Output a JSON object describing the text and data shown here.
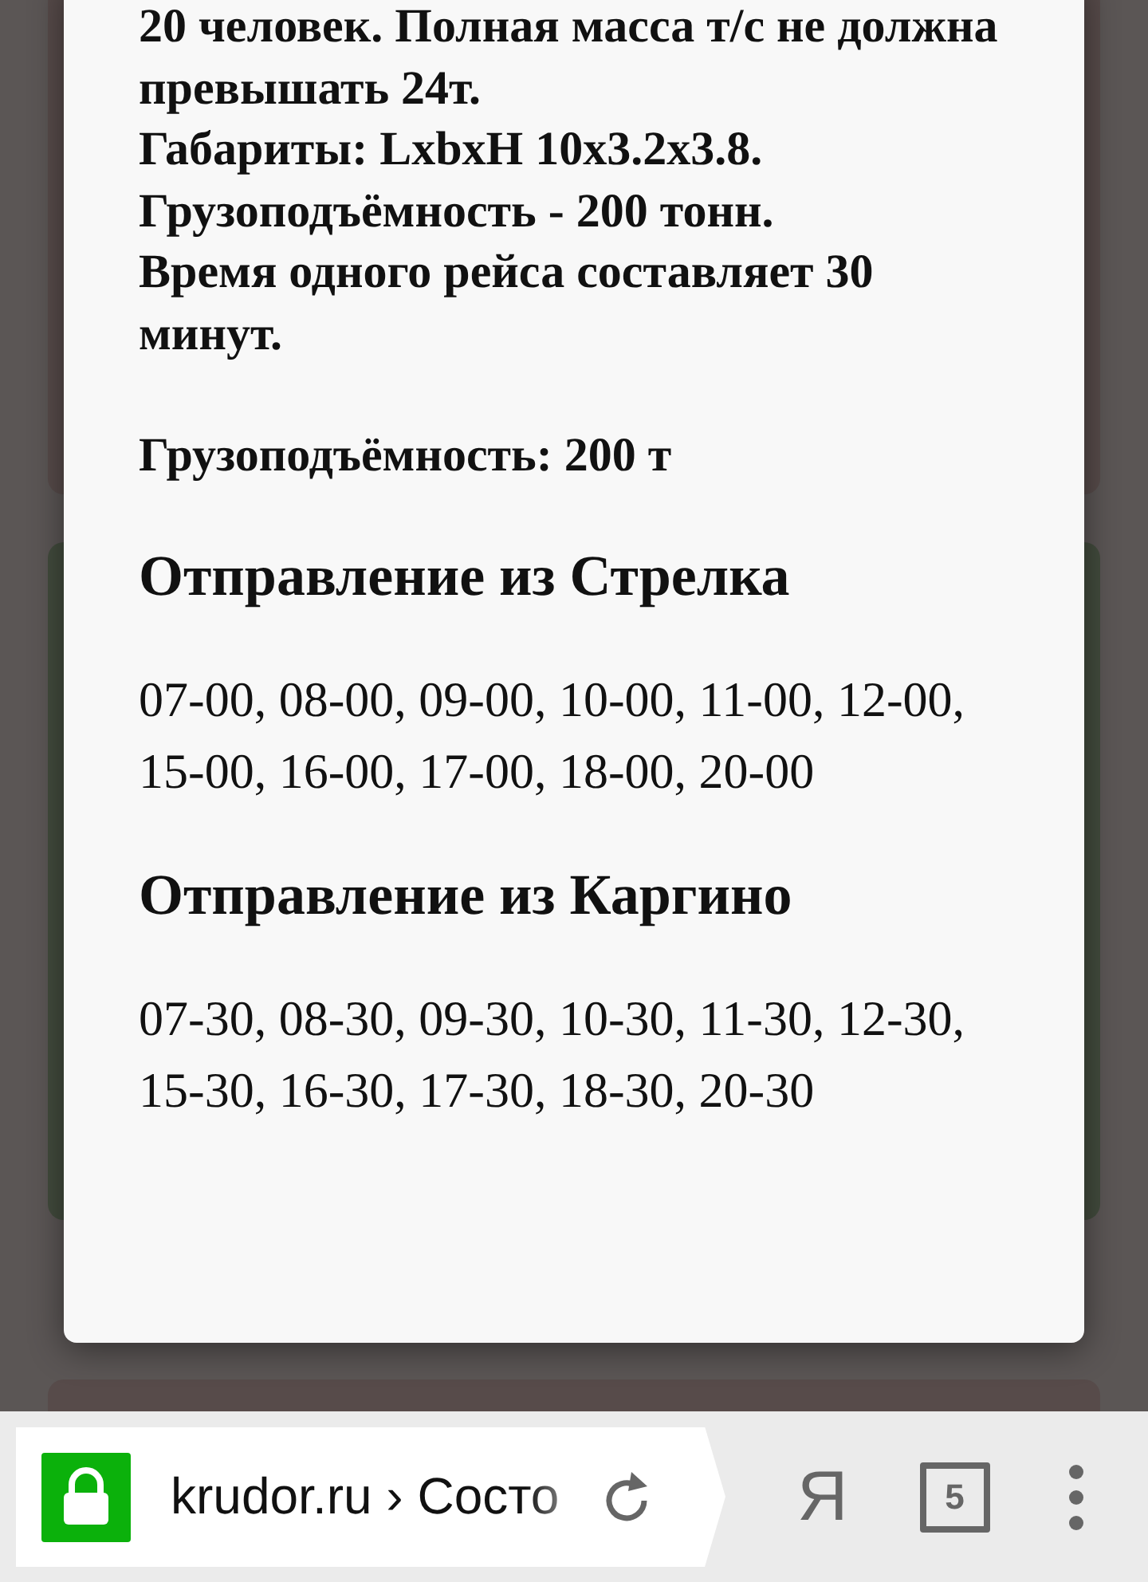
{
  "dialog": {
    "description_lines": [
      "20 человек. Полная масса т/с не должна превышать 24т.",
      "Габариты: LxbxH 10x3.2x3.8.",
      "Грузоподъёмность - 200 тонн.",
      "Время одного рейса составляет 30 минут."
    ],
    "capacity": "Грузоподъёмность: 200 т",
    "schedules": [
      {
        "heading": "Отправление из Стрелка",
        "times": "07-00, 08-00, 09-00, 10-00, 11-00, 12-00, 15-00, 16-00, 17-00, 18-00, 20-00"
      },
      {
        "heading": "Отправление из Каргино",
        "times": "07-30, 08-30, 09-30, 10-30, 11-30, 12-30, 15-30, 16-30, 17-30, 18-30, 20-30"
      }
    ]
  },
  "browser_bar": {
    "secure": true,
    "url": "krudor.ru › Состо",
    "tab_count": "5",
    "search_logo": "Я"
  }
}
